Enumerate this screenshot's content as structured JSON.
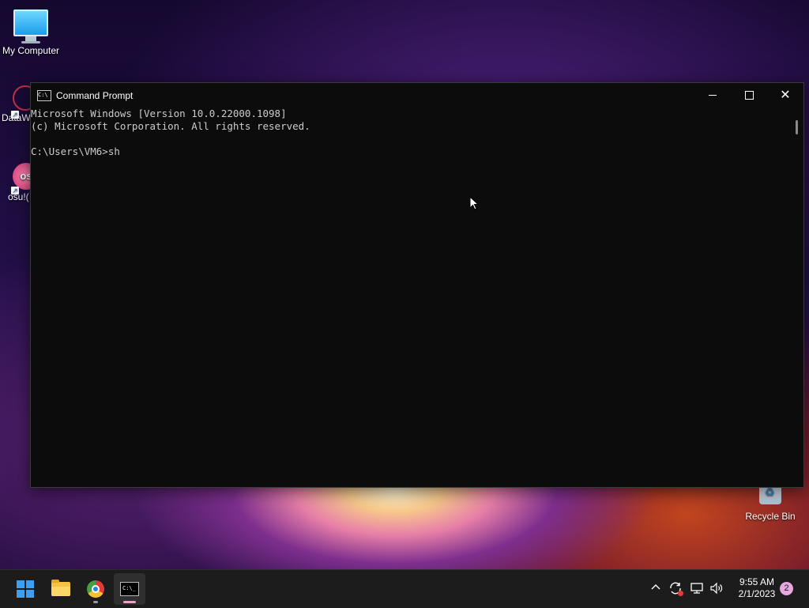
{
  "desktop": {
    "icons": [
      {
        "label": "My Computer"
      },
      {
        "label": "DataW"
      },
      {
        "label": "osu!("
      },
      {
        "label": "Recycle Bin"
      }
    ],
    "osu_glyph": "os"
  },
  "window": {
    "title": "Command Prompt",
    "icon_glyph": "C:\\",
    "console_lines": [
      "Microsoft Windows [Version 10.0.22000.1098]",
      "(c) Microsoft Corporation. All rights reserved.",
      "",
      "C:\\Users\\VM6>sh"
    ]
  },
  "taskbar": {
    "apps": [
      {
        "name": "Start",
        "icon": "windows-logo-icon"
      },
      {
        "name": "File Explorer",
        "icon": "folder-icon"
      },
      {
        "name": "Google Chrome",
        "icon": "chrome-icon"
      },
      {
        "name": "Command Prompt",
        "icon": "cmd-icon"
      }
    ],
    "cmd_glyph": "C:\\_",
    "tray": {
      "clock_time": "9:55 AM",
      "clock_date": "2/1/2023",
      "notification_count": "2"
    }
  },
  "colors": {
    "console_bg": "#0c0c0c",
    "console_fg": "#cccccc",
    "taskbar_bg": "#1c1c1c",
    "accent": "#3aa0f3"
  }
}
